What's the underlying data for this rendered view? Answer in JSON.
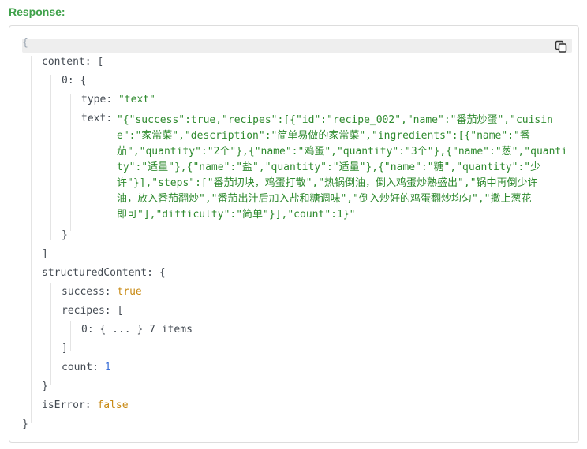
{
  "heading": "Response:",
  "brace_open": "{",
  "brace_close": "}",
  "bracket_open": "[",
  "bracket_close": "]",
  "content": {
    "key": "content",
    "item_index": "0",
    "type_key": "type",
    "type_value": "\"text\"",
    "text_key": "text",
    "text_lines": [
      "\"{\"success\":true,\"recipes\":[{\"id\":\"recipe_002\",\"name\":\"番茄炒蛋\",\"cuisin",
      "e\":\"家常菜\",\"description\":\"简单易做的家常菜\",\"ingredients\":[{\"name\":\"番",
      "茄\",\"quantity\":\"2个\"},{\"name\":\"鸡蛋\",\"quantity\":\"3个\"},{\"name\":\"葱\",\"quanti",
      "ty\":\"适量\"},{\"name\":\"盐\",\"quantity\":\"适量\"},{\"name\":\"糖\",\"quantity\":\"少",
      "许\"}],\"steps\":[\"番茄切块，鸡蛋打散\",\"热锅倒油，倒入鸡蛋炒熟盛出\",\"锅中再倒少许",
      "油，放入番茄翻炒\",\"番茄出汁后加入盐和糖调味\",\"倒入炒好的鸡蛋翻炒均匀\",\"撒上葱花",
      "即可\"],\"difficulty\":\"简单\"}],\"count\":1}\""
    ]
  },
  "structuredContent": {
    "key": "structuredContent",
    "success_key": "success",
    "success_value": "true",
    "recipes_key": "recipes",
    "recipe_index": "0",
    "collapsed": "{ ... }",
    "items_label": "7 items",
    "count_key": "count",
    "count_value": "1"
  },
  "isError": {
    "key": "isError",
    "value": "false"
  }
}
